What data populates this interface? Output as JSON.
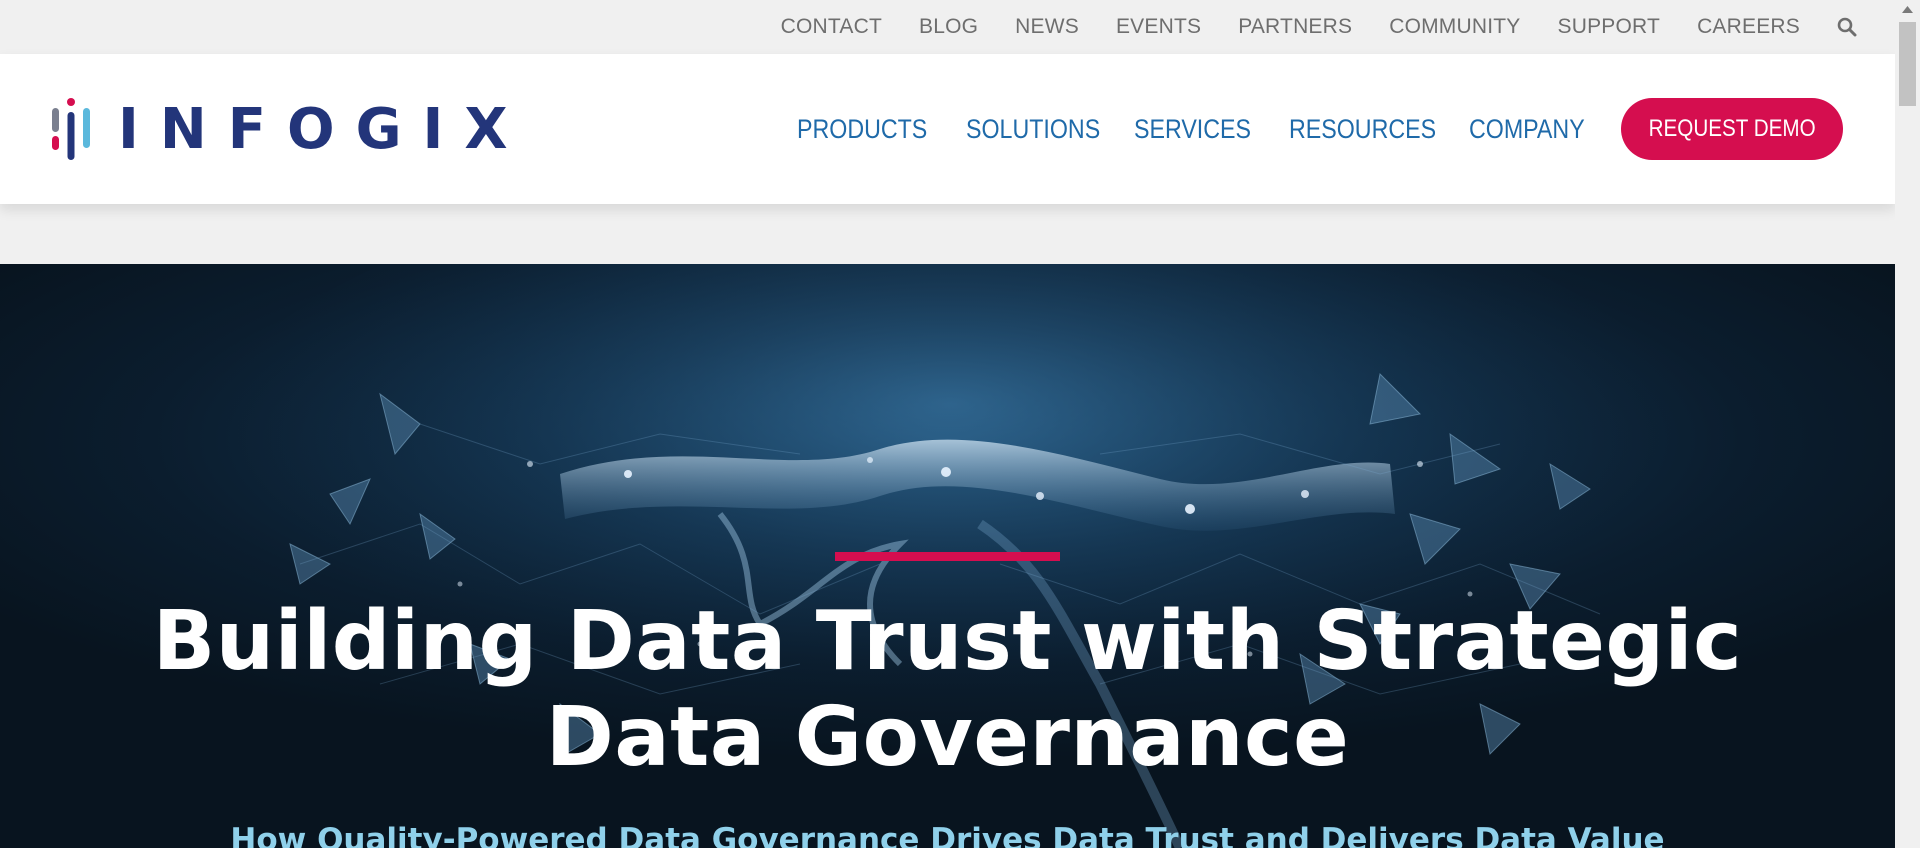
{
  "utility_nav": [
    "CONTACT",
    "BLOG",
    "NEWS",
    "EVENTS",
    "PARTNERS",
    "COMMUNITY",
    "SUPPORT",
    "CAREERS"
  ],
  "utility_icons": {
    "search": "search-icon"
  },
  "logo": {
    "text": "INFOGIX"
  },
  "main_nav": [
    "PRODUCTS",
    "SOLUTIONS",
    "SERVICES",
    "RESOURCES",
    "COMPANY"
  ],
  "cta": {
    "label": "REQUEST DEMO"
  },
  "hero": {
    "title_line1": "Building Data Trust with Strategic",
    "title_line2": "Data Governance",
    "subtitle": "How Quality-Powered Data Governance Drives Data Trust and Delivers Data Value"
  },
  "colors": {
    "brand_navy": "#23357a",
    "nav_blue": "#1f6aa9",
    "accent_red": "#d50e4f",
    "subtitle_cyan": "#8fd0ea",
    "hero_bg": "#0b1d2e"
  }
}
